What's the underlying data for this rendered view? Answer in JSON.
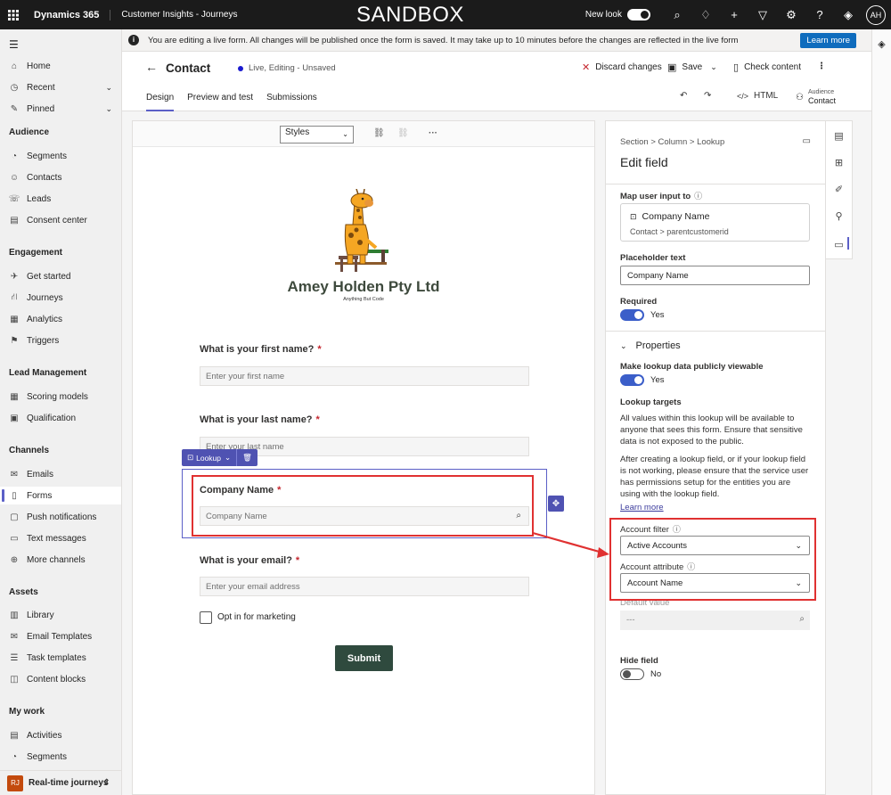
{
  "topbar": {
    "brand": "Dynamics 365",
    "app": "Customer Insights - Journeys",
    "env": "SANDBOX",
    "new_look": "New look",
    "avatar": "AH"
  },
  "notice": {
    "text": "You are editing a live form. All changes will be published once the form is saved. It may take up to 10 minutes before the changes are reflected in the live form",
    "button": "Learn more"
  },
  "sidebar": {
    "items": [
      {
        "label": "Home",
        "icon": "home-icon",
        "glyph": "⌂"
      },
      {
        "label": "Recent",
        "icon": "clock-icon",
        "glyph": "◷"
      },
      {
        "label": "Pinned",
        "icon": "pin-icon",
        "glyph": "✎"
      }
    ],
    "groups": [
      {
        "title": "Audience",
        "items": [
          {
            "label": "Segments",
            "glyph": "◔"
          },
          {
            "label": "Contacts",
            "glyph": "☺"
          },
          {
            "label": "Leads",
            "glyph": "☏"
          },
          {
            "label": "Consent center",
            "glyph": "▤"
          }
        ]
      },
      {
        "title": "Engagement",
        "items": [
          {
            "label": "Get started",
            "glyph": "✈"
          },
          {
            "label": "Journeys",
            "glyph": "⛙"
          },
          {
            "label": "Analytics",
            "glyph": "▦"
          },
          {
            "label": "Triggers",
            "glyph": "⚑"
          }
        ]
      },
      {
        "title": "Lead Management",
        "items": [
          {
            "label": "Scoring models",
            "glyph": "▦"
          },
          {
            "label": "Qualification",
            "glyph": "▣"
          }
        ]
      },
      {
        "title": "Channels",
        "items": [
          {
            "label": "Emails",
            "glyph": "✉"
          },
          {
            "label": "Forms",
            "glyph": "▯"
          },
          {
            "label": "Push notifications",
            "glyph": "▢"
          },
          {
            "label": "Text messages",
            "glyph": "▭"
          },
          {
            "label": "More channels",
            "glyph": "⊕"
          }
        ]
      },
      {
        "title": "Assets",
        "items": [
          {
            "label": "Library",
            "glyph": "▥"
          },
          {
            "label": "Email Templates",
            "glyph": "✉"
          },
          {
            "label": "Task templates",
            "glyph": "☰"
          },
          {
            "label": "Content blocks",
            "glyph": "◫"
          }
        ]
      },
      {
        "title": "My work",
        "items": [
          {
            "label": "Activities",
            "glyph": "▤"
          },
          {
            "label": "Segments",
            "glyph": "◔"
          }
        ]
      }
    ],
    "footer": {
      "badge": "RJ",
      "label": "Real-time journeys"
    }
  },
  "header": {
    "title": "Contact",
    "status": "Live, Editing - Unsaved",
    "discard": "Discard changes",
    "save": "Save",
    "check": "Check content",
    "tabs": [
      "Design",
      "Preview and test",
      "Submissions"
    ],
    "html": "HTML",
    "audience_label": "Audience",
    "audience_value": "Contact"
  },
  "canvas": {
    "styles": "Styles",
    "company": "Amey Holden Pty Ltd",
    "tagline": "Anything But Code",
    "lookup_tag": "Lookup",
    "fields": [
      {
        "label": "What is your first name?",
        "placeholder": "Enter your first name"
      },
      {
        "label": "What is your last name?",
        "placeholder": "Enter your last name"
      },
      {
        "label": "Company Name",
        "placeholder": "Company Name"
      },
      {
        "label": "What is your email?",
        "placeholder": "Enter your email address"
      }
    ],
    "checkbox": "Opt in for marketing",
    "submit": "Submit"
  },
  "panel": {
    "breadcrumb": "Section  >  Column  >  Lookup",
    "title": "Edit field",
    "map_label": "Map user input to",
    "map_name": "Company Name",
    "map_path": "Contact  >  parentcustomerid",
    "placeholder_label": "Placeholder text",
    "placeholder_value": "Company Name",
    "required_label": "Required",
    "required_value": "Yes",
    "properties": "Properties",
    "public_label": "Make lookup data publicly viewable",
    "public_value": "Yes",
    "targets_label": "Lookup targets",
    "targets_text": "All values within this lookup will be available to anyone that sees this form. Ensure that sensitive data is not exposed to the public.",
    "warning_text": "After creating a lookup field, or if your lookup field is not working, please ensure that the service user has permissions setup for the entities you are using with the lookup field.",
    "learn_more": "Learn more",
    "filter_label": "Account filter",
    "filter_value": "Active Accounts",
    "attr_label": "Account attribute",
    "attr_value": "Account Name",
    "default_label": "Default value",
    "default_value": "---",
    "hide_label": "Hide field",
    "hide_value": "No"
  },
  "colors": {
    "accent": "#5b5fc7",
    "highlight": "#e03131",
    "submit": "#2f4a3e"
  }
}
